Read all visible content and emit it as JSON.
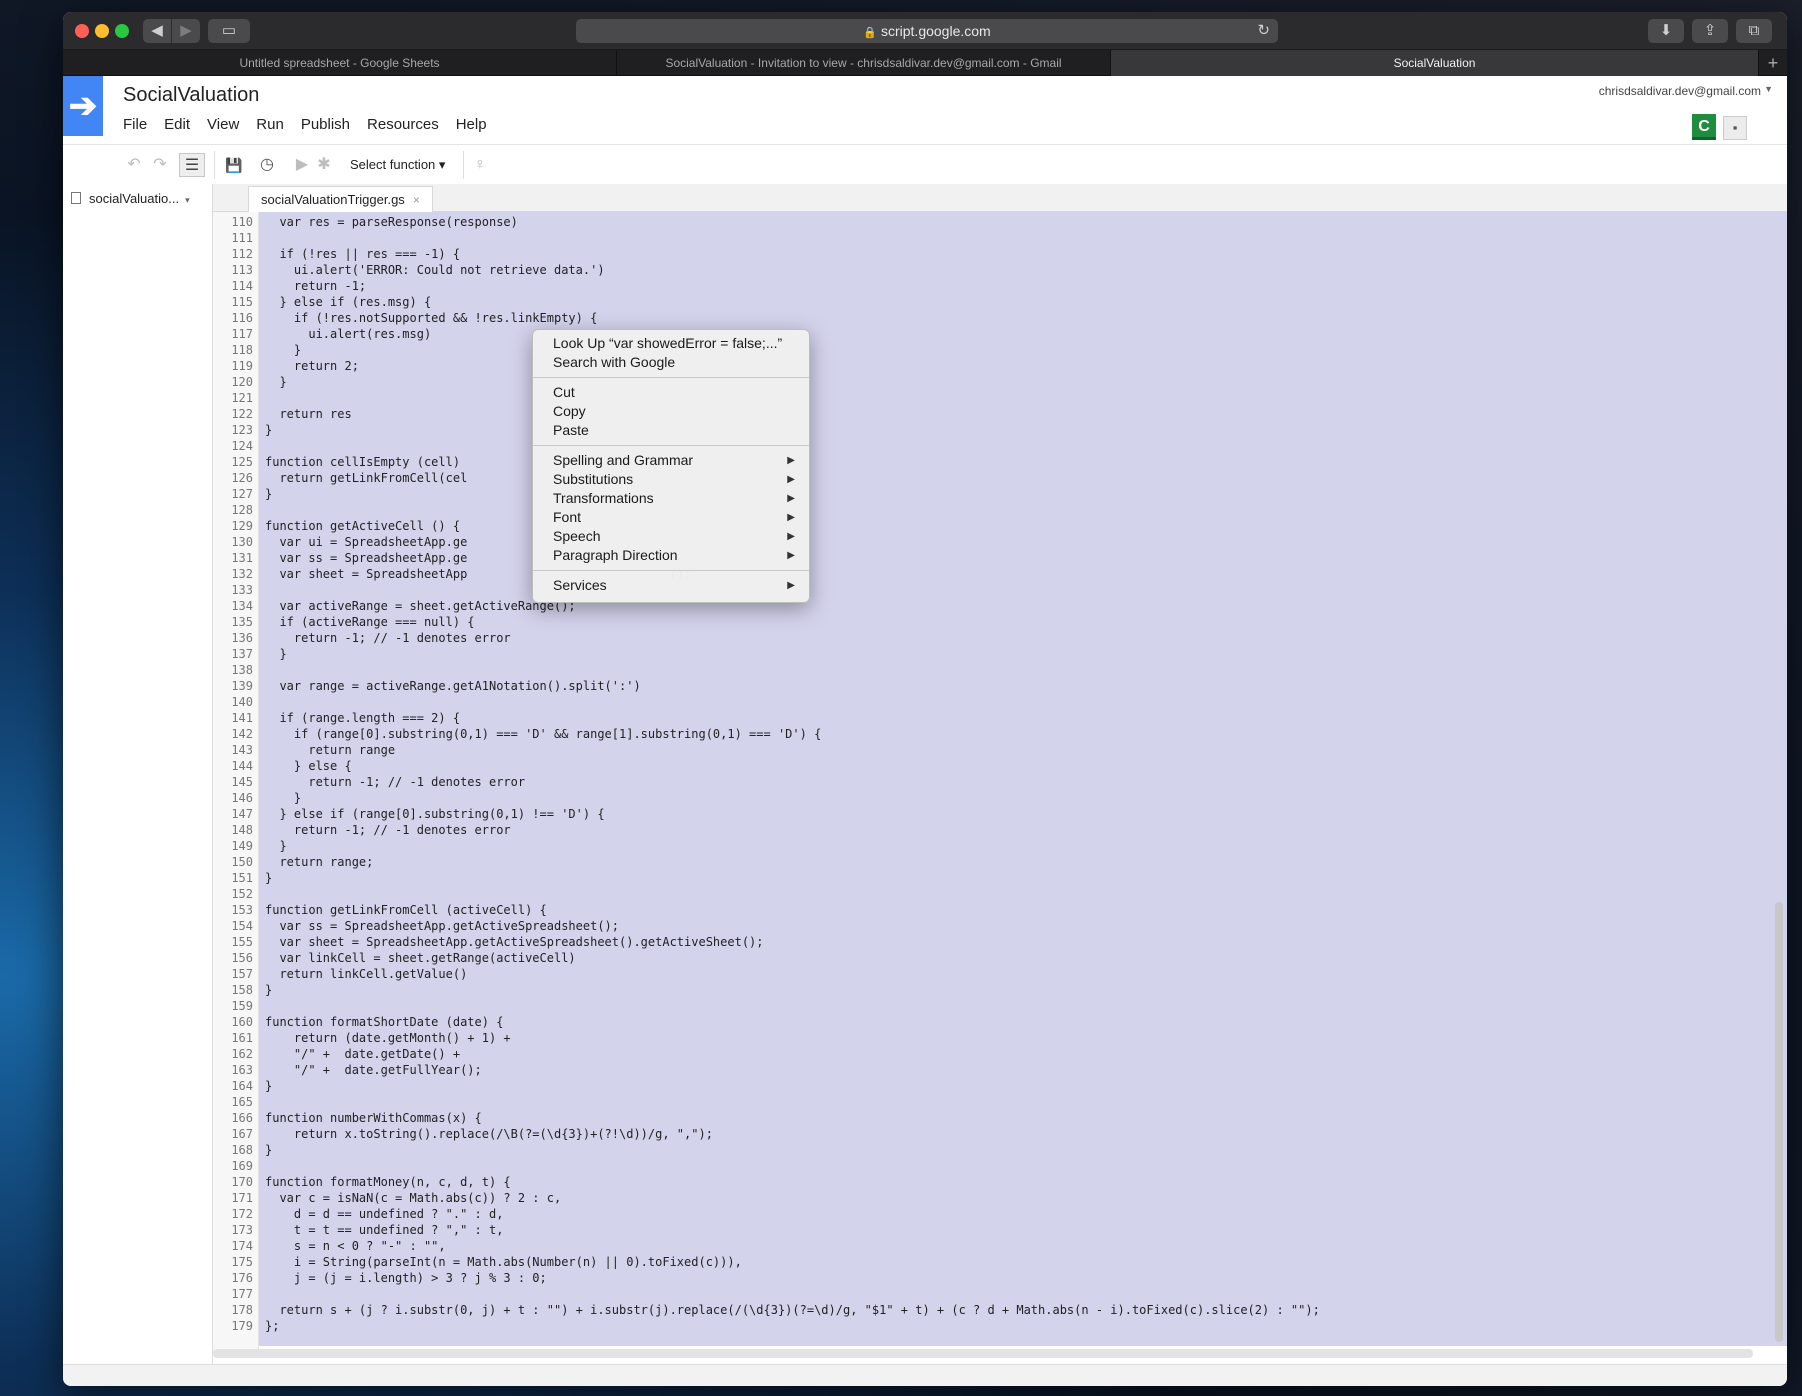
{
  "browser": {
    "url": "script.google.com",
    "tabs": [
      {
        "title": "Untitled spreadsheet - Google Sheets"
      },
      {
        "title": "SocialValuation - Invitation to view - chrisdsaldivar.dev@gmail.com - Gmail"
      },
      {
        "title": "SocialValuation"
      }
    ],
    "icons": {
      "back": "◀",
      "forward": "▶",
      "sidebar": "▭",
      "lock": "🔒",
      "reload": "↻",
      "download": "⬇",
      "share": "⇪",
      "tabs": "⧉",
      "new_tab": "+"
    }
  },
  "app": {
    "title": "SocialValuation",
    "logo_glyph": "➔",
    "menu": [
      "File",
      "Edit",
      "View",
      "Run",
      "Publish",
      "Resources",
      "Help"
    ],
    "account_email": "chrisdsaldivar.dev@gmail.com",
    "avatar_letter": "C",
    "chat_icon": "▪",
    "accent_color": "#4285f4"
  },
  "toolbar": {
    "undo": "↶",
    "redo": "↷",
    "indent": "☰",
    "save": "💾",
    "triggers": "◷",
    "run": "▶",
    "debug": "✱",
    "select_function": "Select function ▾",
    "lightbulb": "♀"
  },
  "file_panel": {
    "file_name": "socialValuatio...",
    "caret": "▾"
  },
  "editor": {
    "tab_label": "socialValuationTrigger.gs",
    "tab_close": "×",
    "lines": [
      {
        "n": "110",
        "code": "  var res = parseResponse(response)"
      },
      {
        "n": "111",
        "code": ""
      },
      {
        "n": "112",
        "code": "  if (!res || res === -1) {"
      },
      {
        "n": "113",
        "code": "    ui.alert('ERROR: Could not retrieve data.')"
      },
      {
        "n": "114",
        "code": "    return -1;"
      },
      {
        "n": "115",
        "code": "  } else if (res.msg) {"
      },
      {
        "n": "116",
        "code": "    if (!res.notSupported && !res.linkEmpty) {"
      },
      {
        "n": "117",
        "code": "      ui.alert(res.msg)"
      },
      {
        "n": "118",
        "code": "    }"
      },
      {
        "n": "119",
        "code": "    return 2;"
      },
      {
        "n": "120",
        "code": "  }"
      },
      {
        "n": "121",
        "code": ""
      },
      {
        "n": "122",
        "code": "  return res"
      },
      {
        "n": "123",
        "code": "}"
      },
      {
        "n": "124",
        "code": ""
      },
      {
        "n": "125",
        "code": "function cellIsEmpty (cell)"
      },
      {
        "n": "126",
        "code": "  return getLinkFromCell(cel"
      },
      {
        "n": "127",
        "code": "}"
      },
      {
        "n": "128",
        "code": ""
      },
      {
        "n": "129",
        "code": "function getActiveCell () {"
      },
      {
        "n": "130",
        "code": "  var ui = SpreadsheetApp.ge"
      },
      {
        "n": "131",
        "code": "  var ss = SpreadsheetApp.ge"
      },
      {
        "n": "132",
        "code": "  var sheet = SpreadsheetApp                            ();"
      },
      {
        "n": "133",
        "code": ""
      },
      {
        "n": "134",
        "code": "  var activeRange = sheet.getActiveRange();"
      },
      {
        "n": "135",
        "code": "  if (activeRange === null) {"
      },
      {
        "n": "136",
        "code": "    return -1; // -1 denotes error"
      },
      {
        "n": "137",
        "code": "  }"
      },
      {
        "n": "138",
        "code": ""
      },
      {
        "n": "139",
        "code": "  var range = activeRange.getA1Notation().split(':')"
      },
      {
        "n": "140",
        "code": ""
      },
      {
        "n": "141",
        "code": "  if (range.length === 2) {"
      },
      {
        "n": "142",
        "code": "    if (range[0].substring(0,1) === 'D' && range[1].substring(0,1) === 'D') {"
      },
      {
        "n": "143",
        "code": "      return range"
      },
      {
        "n": "144",
        "code": "    } else {"
      },
      {
        "n": "145",
        "code": "      return -1; // -1 denotes error"
      },
      {
        "n": "146",
        "code": "    }"
      },
      {
        "n": "147",
        "code": "  } else if (range[0].substring(0,1) !== 'D') {"
      },
      {
        "n": "148",
        "code": "    return -1; // -1 denotes error"
      },
      {
        "n": "149",
        "code": "  }"
      },
      {
        "n": "150",
        "code": "  return range;"
      },
      {
        "n": "151",
        "code": "}"
      },
      {
        "n": "152",
        "code": ""
      },
      {
        "n": "153",
        "code": "function getLinkFromCell (activeCell) {"
      },
      {
        "n": "154",
        "code": "  var ss = SpreadsheetApp.getActiveSpreadsheet();"
      },
      {
        "n": "155",
        "code": "  var sheet = SpreadsheetApp.getActiveSpreadsheet().getActiveSheet();"
      },
      {
        "n": "156",
        "code": "  var linkCell = sheet.getRange(activeCell)"
      },
      {
        "n": "157",
        "code": "  return linkCell.getValue()"
      },
      {
        "n": "158",
        "code": "}"
      },
      {
        "n": "159",
        "code": ""
      },
      {
        "n": "160",
        "code": "function formatShortDate (date) {"
      },
      {
        "n": "161",
        "code": "    return (date.getMonth() + 1) +"
      },
      {
        "n": "162",
        "code": "    \"/\" +  date.getDate() +"
      },
      {
        "n": "163",
        "code": "    \"/\" +  date.getFullYear();"
      },
      {
        "n": "164",
        "code": "}"
      },
      {
        "n": "165",
        "code": ""
      },
      {
        "n": "166",
        "code": "function numberWithCommas(x) {"
      },
      {
        "n": "167",
        "code": "    return x.toString().replace(/\\B(?=(\\d{3})+(?!\\d))/g, \",\");"
      },
      {
        "n": "168",
        "code": "}"
      },
      {
        "n": "169",
        "code": ""
      },
      {
        "n": "170",
        "code": "function formatMoney(n, c, d, t) {"
      },
      {
        "n": "171",
        "code": "  var c = isNaN(c = Math.abs(c)) ? 2 : c,"
      },
      {
        "n": "172",
        "code": "    d = d == undefined ? \".\" : d,"
      },
      {
        "n": "173",
        "code": "    t = t == undefined ? \",\" : t,"
      },
      {
        "n": "174",
        "code": "    s = n < 0 ? \"-\" : \"\","
      },
      {
        "n": "175",
        "code": "    i = String(parseInt(n = Math.abs(Number(n) || 0).toFixed(c))),"
      },
      {
        "n": "176",
        "code": "    j = (j = i.length) > 3 ? j % 3 : 0;"
      },
      {
        "n": "177",
        "code": ""
      },
      {
        "n": "178",
        "code": "  return s + (j ? i.substr(0, j) + t : \"\") + i.substr(j).replace(/(\\d{3})(?=\\d)/g, \"$1\" + t) + (c ? d + Math.abs(n - i).toFixed(c).slice(2) : \"\");"
      },
      {
        "n": "179",
        "code": "};"
      }
    ]
  },
  "context_menu": {
    "items": [
      {
        "label": "Look Up “var showedError = false;...”",
        "submenu": false
      },
      {
        "label": "Search with Google",
        "submenu": false
      },
      {
        "sep": true
      },
      {
        "label": "Cut",
        "submenu": false
      },
      {
        "label": "Copy",
        "submenu": false
      },
      {
        "label": "Paste",
        "submenu": false
      },
      {
        "sep": true
      },
      {
        "label": "Spelling and Grammar",
        "submenu": true
      },
      {
        "label": "Substitutions",
        "submenu": true
      },
      {
        "label": "Transformations",
        "submenu": true
      },
      {
        "label": "Font",
        "submenu": true
      },
      {
        "label": "Speech",
        "submenu": true
      },
      {
        "label": "Paragraph Direction",
        "submenu": true
      },
      {
        "sep": true
      },
      {
        "label": "Services",
        "submenu": true
      }
    ],
    "arrow_glyph": "▶"
  }
}
